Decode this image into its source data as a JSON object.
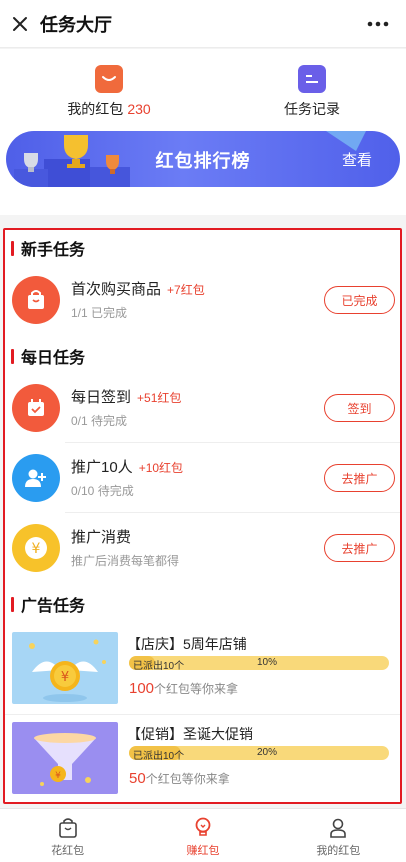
{
  "header": {
    "title": "任务大厅"
  },
  "summary": {
    "redpacket_label": "我的红包",
    "redpacket_count": "230",
    "records_label": "任务记录"
  },
  "ranking": {
    "title": "红包排行榜",
    "view_label": "查看"
  },
  "sections": {
    "newbie": "新手任务",
    "daily": "每日任务",
    "ads": "广告任务"
  },
  "tasks": [
    {
      "name": "首次购买商品",
      "reward": "+7红包",
      "sub": "1/1 已完成",
      "button": "已完成"
    },
    {
      "name": "每日签到",
      "reward": "+51红包",
      "sub": "0/1 待完成",
      "button": "签到"
    },
    {
      "name": "推广10人",
      "reward": "+10红包",
      "sub": "0/10 待完成",
      "button": "去推广"
    },
    {
      "name": "推广消费",
      "reward": "",
      "sub": "推广后消费每笔都得",
      "button": "去推广"
    }
  ],
  "ads": [
    {
      "title": "【店庆】5周年店铺",
      "dispatched": "已派出10个",
      "percent": "10%",
      "progress": 0.1,
      "count": "100",
      "count_suffix": "个红包等你来拿"
    },
    {
      "title": "【促销】圣诞大促销",
      "dispatched": "已派出10个",
      "percent": "20%",
      "progress": 0.2,
      "count": "50",
      "count_suffix": "个红包等你来拿"
    }
  ],
  "tabbar": [
    {
      "label": "花红包",
      "icon": "shopping-bag-icon",
      "active": false
    },
    {
      "label": "赚红包",
      "icon": "lightbulb-icon",
      "active": true
    },
    {
      "label": "我的红包",
      "icon": "user-icon",
      "active": false
    }
  ],
  "colors": {
    "accent": "#e8412f",
    "highlight_border": "#e21b22",
    "banner": "#5b6cf0"
  }
}
